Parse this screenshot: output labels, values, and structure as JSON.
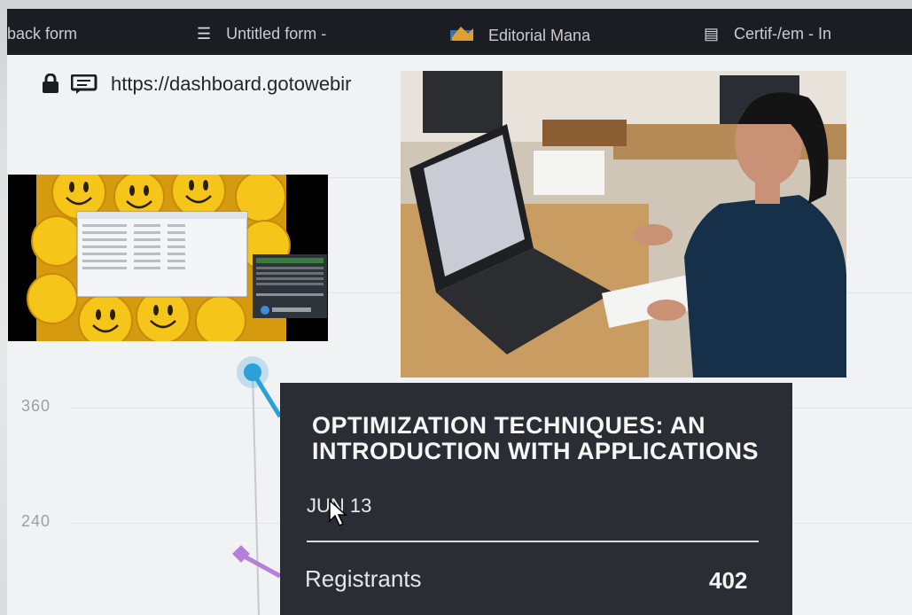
{
  "browser": {
    "tabs": [
      {
        "label": "back form",
        "icon": "form-icon"
      },
      {
        "label": "Untitled form -",
        "icon": "list-icon"
      },
      {
        "label": "Editorial Mana",
        "icon": "editorial-icon"
      },
      {
        "label": "Certif-/em - In",
        "icon": "form-icon"
      }
    ],
    "url": "https://dashboard.gotowebir"
  },
  "chart": {
    "y_ticks": [
      "360",
      "240"
    ]
  },
  "tooltip": {
    "title": "OPTIMIZATION TECHNIQUES: AN INTRODUCTION WITH APPLICATIONS",
    "date": "JUN 13",
    "metric_label": "Registrants",
    "metric_value": "402"
  },
  "colors": {
    "accent_point": "#2b9fd8",
    "purple_point": "#b780d8",
    "tooltip_bg": "#2a2d33"
  }
}
